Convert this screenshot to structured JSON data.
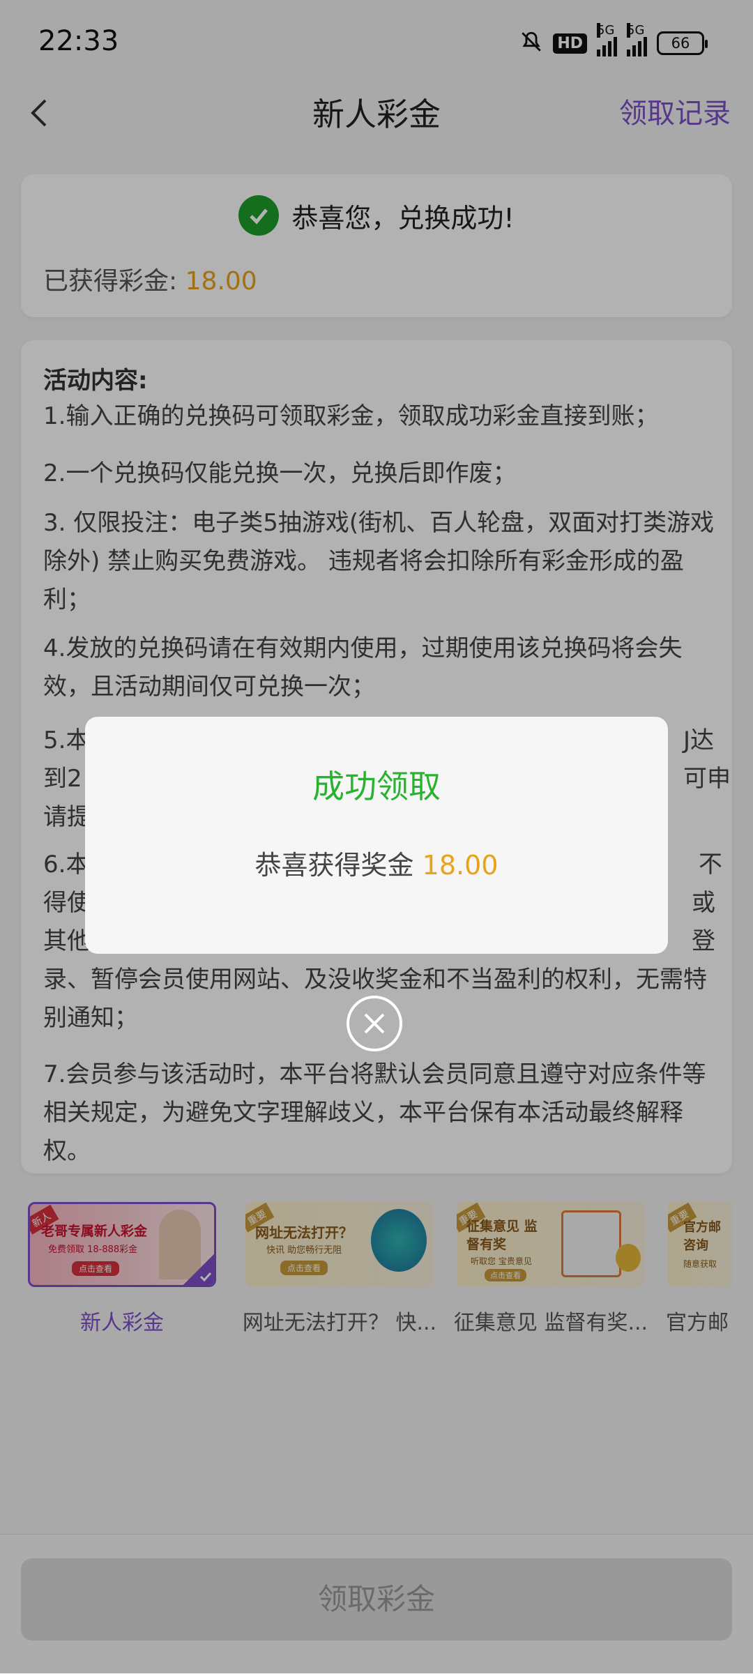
{
  "status_bar": {
    "time": "22:33",
    "hd": "HD",
    "network1": "5G",
    "network2": "5G",
    "battery": "66"
  },
  "header": {
    "title": "新人彩金",
    "records_link": "领取记录"
  },
  "success_card": {
    "message": "恭喜您，兑换成功!",
    "earned_label": "已获得彩金:",
    "earned_amount": "18.00"
  },
  "rules": {
    "title": "活动内容:",
    "items": [
      "1.输入正确的兑换码可领取彩金，领取成功彩金直接到账；",
      "2.一个兑换码仅能兑换一次，兑换后即作废；",
      "3. 仅限投注：电子类5抽游戏(街机、百人轮盘，双面对打类游戏除外) 禁止购买免费游戏。 违规者将会扣除所有彩金形成的盈利；",
      "4.发放的兑换码请在有效期内使用，过期使用该兑换码将会失效，且活动期间仅可兑换一次；",
      "5.本",
      "到2",
      "请提",
      "6.本",
      "得使",
      "其他",
      "录、暂停会员使用网站、及没收奖金和不当盈利的权利，无需特别通知；",
      "7.会员参与该活动时，本平台将默认会员同意且遵守对应条件等相关规定，为避免文字理解歧义，本平台保有本活动最终解释权。"
    ],
    "fragments_right": [
      "J达",
      "可申",
      "不",
      "或",
      "登"
    ]
  },
  "banners": [
    {
      "label": "新人彩金",
      "title": "老哥专属新人彩金",
      "subtitle": "免费领取 18-888彩金",
      "button": "点击查看",
      "tag": "新人",
      "selected": true
    },
    {
      "label": "网址无法打开？ 快...",
      "title": "网址无法打开？",
      "subtitle": "快讯 助您畅行无阻",
      "button": "点击查看",
      "tag": "重要",
      "selected": false
    },
    {
      "label": "征集意见 监督有奖...",
      "title": "征集意见 监督有奖",
      "subtitle": "听取您 宝贵意见",
      "button": "点击查看",
      "tag": "重要",
      "selected": false
    },
    {
      "label": "官方邮",
      "title": "官方邮 咨询",
      "subtitle": "随意获取",
      "button": "点击查看",
      "tag": "重要",
      "selected": false
    }
  ],
  "claim_button": "领取彩金",
  "modal": {
    "title": "成功领取",
    "message_prefix": "恭喜获得奖金",
    "amount": "18.00"
  },
  "colors": {
    "accent": "#7b4fc9",
    "amount": "#e8a31b",
    "success": "#27b32f"
  }
}
